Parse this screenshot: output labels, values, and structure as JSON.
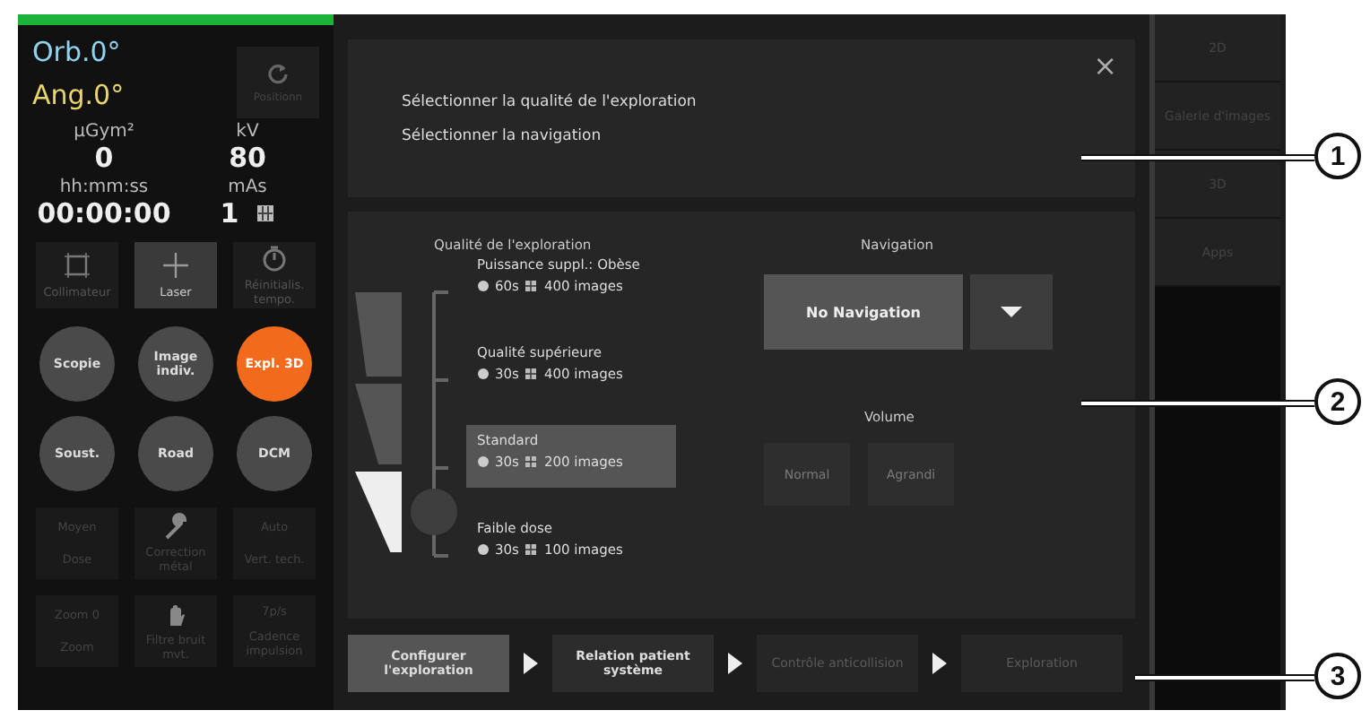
{
  "readouts": {
    "orbital": "Orb.0°",
    "angular": "Ang.0°"
  },
  "position_button": {
    "label": "Positionn",
    "disabled": true
  },
  "measures": [
    {
      "label": "µGym²",
      "value": "0"
    },
    {
      "label": "kV",
      "value": "80"
    },
    {
      "label": "hh:mm:ss",
      "value": "00:00:00"
    },
    {
      "label": "mAs",
      "value": "1"
    }
  ],
  "tools": [
    {
      "kind": "collimator",
      "label": "Collimateur",
      "disabled": true
    },
    {
      "kind": "laser",
      "label": "Laser",
      "disabled": false
    },
    {
      "kind": "timer",
      "label": "Réinitialis. tempo.",
      "disabled": true
    }
  ],
  "modes": [
    {
      "label": "Scopie",
      "selected": false
    },
    {
      "label": "Image indiv.",
      "selected": false
    },
    {
      "label": "Expl. 3D",
      "selected": true
    },
    {
      "label": "Soust.",
      "selected": false
    },
    {
      "label": "Road",
      "selected": false
    },
    {
      "label": "DCM",
      "selected": false
    }
  ],
  "settings": [
    {
      "kind": "value",
      "value": "Moyen",
      "label": "Dose",
      "disabled": true
    },
    {
      "kind": "wrench",
      "label": "Correction métal",
      "disabled": true
    },
    {
      "kind": "value",
      "value": "Auto",
      "label": "Vert. tech.",
      "disabled": true
    },
    {
      "kind": "value",
      "value": "Zoom 0",
      "label": "Zoom",
      "disabled": true
    },
    {
      "kind": "hand",
      "label": "Filtre bruit mvt.",
      "disabled": true
    },
    {
      "kind": "value",
      "value": "7p/s",
      "label": "Cadence impulsion",
      "disabled": true
    }
  ],
  "dialog": {
    "lines": [
      "Sélectionner la qualité de l'exploration",
      "Sélectionner la navigation"
    ],
    "close": "×"
  },
  "quality": {
    "title": "Qualité de l'exploration",
    "levels": [
      {
        "name": "Puissance suppl.: Obèse",
        "time": "60s",
        "images": "400 images",
        "selected": false
      },
      {
        "name": "Qualité supérieure",
        "time": "30s",
        "images": "400 images",
        "selected": false
      },
      {
        "name": "Standard",
        "time": "30s",
        "images": "200 images",
        "selected": true
      },
      {
        "name": "Faible dose",
        "time": "30s",
        "images": "100 images",
        "selected": false
      }
    ]
  },
  "navigation": {
    "title": "Navigation",
    "value": "No Navigation"
  },
  "volume": {
    "title": "Volume",
    "buttons": [
      {
        "label": "Normal",
        "disabled": true
      },
      {
        "label": "Agrandi",
        "disabled": true
      }
    ]
  },
  "steps": [
    {
      "label": "Configurer l'exploration",
      "selected": true,
      "disabled": false
    },
    {
      "label": "Relation patient système",
      "selected": false,
      "disabled": false
    },
    {
      "label": "Contrôle anticollision",
      "selected": false,
      "disabled": true
    },
    {
      "label": "Exploration",
      "selected": false,
      "disabled": true
    }
  ],
  "side_tabs": [
    {
      "label": "2D"
    },
    {
      "label": "Galerie d'images"
    },
    {
      "label": "3D"
    },
    {
      "label": "Apps"
    }
  ],
  "callouts": [
    "1",
    "2",
    "3"
  ]
}
